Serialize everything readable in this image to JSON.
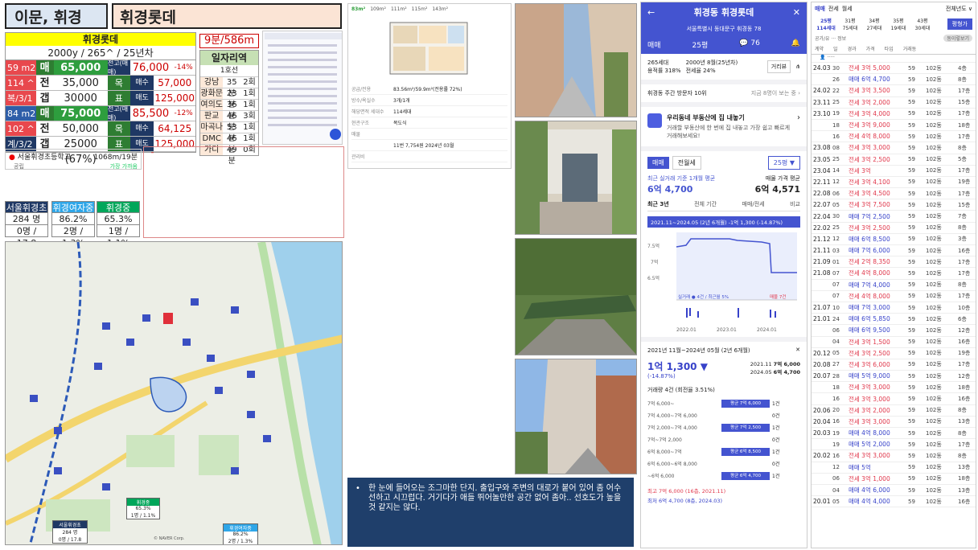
{
  "header": {
    "region": "이문, 휘경",
    "complex": "휘경롯데"
  },
  "price_table": {
    "title": "휘경롯데",
    "subtitle": "2000y / 265^ / 25년차",
    "rows": [
      {
        "a": "59 m2",
        "b": "매",
        "c": "65,000",
        "d": "전고(매매)",
        "e": "76,000",
        "f": "-14%",
        "color": "red"
      },
      {
        "a": "114 ^",
        "b": "전",
        "c": "35,000",
        "d": "목",
        "e": "매수",
        "f": "57,000",
        "color": "red"
      },
      {
        "a": "복/3/1",
        "b": "갭",
        "c": "30000 (54%)",
        "d": "표",
        "e": "매도",
        "f": "125,000",
        "color": "red"
      },
      {
        "a": "84 m2",
        "b": "매",
        "c": "75,000",
        "d": "전고(매매)",
        "e": "85,500",
        "f": "-12%",
        "color": "blue"
      },
      {
        "a": "102 ^",
        "b": "전",
        "c": "50,000",
        "d": "목",
        "e": "매수",
        "f": "64,125",
        "color": "red"
      },
      {
        "a": "계/3/2",
        "b": "갭",
        "c": "25000 (67%)",
        "d": "표",
        "e": "매도",
        "f": "125,000",
        "color": "dk"
      }
    ]
  },
  "distance": "9분/586m",
  "work": {
    "title": "일자리역",
    "sub": "1호선",
    "rows": [
      [
        "강남",
        "35분",
        "2회"
      ],
      [
        "광화문",
        "23분",
        "1회"
      ],
      [
        "여의도",
        "36분",
        "1회"
      ],
      [
        "판교",
        "46분",
        "3회"
      ],
      [
        "마곡나루",
        "53분",
        "1회"
      ],
      [
        "DMC",
        "46분",
        "1회"
      ],
      [
        "가디",
        "49분",
        "0회"
      ]
    ]
  },
  "school": {
    "name": "서울휘경초등학교",
    "dist": "1068m/19분",
    "tag1": "공립",
    "tag2": "가장 가까움"
  },
  "schools": [
    {
      "name": "서울휘경초",
      "l2": "284 명",
      "l3": "0명 / 17.8",
      "color": "dk"
    },
    {
      "name": "휘경여자중",
      "l2": "86.2%",
      "l3": "2명 / 1.3%",
      "color": "cy"
    },
    {
      "name": "휘경중",
      "l2": "65.3%",
      "l3": "1명 / 1.1%",
      "color": "gr"
    }
  ],
  "map_labels": {
    "school1": "휘경중",
    "school1_l2": "65.3%",
    "school1_l3": "1명 / 1.1%",
    "school2": "서울휘경초",
    "school2_l2": "284 명",
    "school2_l3": "0명 / 17.8",
    "school3": "휘경여자중",
    "school3_l2": "86.2%",
    "school3_l3": "2명 / 1.3%",
    "credit": "© NAVER Corp."
  },
  "floor": {
    "tabs": [
      "83m²",
      "109m²",
      "111m²",
      "115m²",
      "143m²"
    ],
    "f1": "공급/전용",
    "f1v": "83.56m²/59.9m²(전용률 72%)",
    "f2": "방수/욕실수",
    "f2v": "3개/1개",
    "f3": "해당면적 세대수",
    "f3v": "114세대",
    "f4": "현관구조",
    "f4v": "복도식",
    "f5": "매물",
    "f6": "11번 7,754원  2024년 03월",
    "f7": "관리비"
  },
  "note": "한 눈에 들어오는 조그마한 단지. 출입구와 주변의 대로가 붙어 있어 좀 어수선하고 시끄럽다. 거기다가 애들 뛰어놀만한 공간 없어 좀아.. 선호도가 높을 것 같지는 않다.",
  "mobile": {
    "title": "휘경동 휘경롯데",
    "addr": "서울특별시 동대문구 휘경동 78",
    "tab1": "매매",
    "tab2": "25평",
    "comments": "76",
    "info1": "265세대",
    "info2": "2000년 8월(25년차)",
    "info3": "용적률 318%",
    "info4": "전세율 24%",
    "dist_btn": "거리뷰",
    "visits": "휘경동 주간 방문자 10위",
    "visits_r": "지금 8명이 보는 중 ›",
    "ad_t": "우리동네 부동산에 집 내놓기",
    "ad_s": "거래할 부동산에 한 번에 집 내놓고 가장 쉽고 빠르게 거래해보세요!",
    "t_buy": "매매",
    "t_rent": "전월세",
    "size_sel": "25평 ▼",
    "recent_l": "최근 실거래 기준 1개월 평균",
    "recent_v": "6억 4,700",
    "listing_l": "매물 가격 평균",
    "listing_v": "6억 4,571",
    "range_tabs": [
      "최근 3년",
      "전체 기간",
      "매매/전세",
      "비교"
    ],
    "chart_head": "2021.11~2024.05 (2년 6개월) -1억 1,300 (-14.87%)",
    "y_labels": [
      "7.5억",
      "7억",
      "6.5억"
    ],
    "x_labels": [
      "2022.01",
      "2023.01",
      "2024.01"
    ],
    "legend": "실거래 ● 4건 / 최근월 5%",
    "legend2": "매물 7건",
    "period": "2021년 11월~2024년 05월 (2년 6개월)",
    "change": "1억 1,300 ▼",
    "change_pct": "(-14.87%)",
    "hi_d": "2021.11",
    "hi_v": "7억 6,000",
    "lo_d": "2024.05",
    "lo_v": "6억 4,700",
    "vol": "거래량 4건 (회전율 3.51%)",
    "bins": [
      {
        "r": "7억 6,000~",
        "bar": "평균 7억 6,000",
        "n": "1건"
      },
      {
        "r": "7억 4,000~7억 6,000",
        "bar": "",
        "n": "0건"
      },
      {
        "r": "7억 2,000~7억 4,000",
        "bar": "평균 7억 2,500",
        "n": "1건"
      },
      {
        "r": "7억~7억 2,000",
        "bar": "",
        "n": "0건"
      },
      {
        "r": "6억 8,000~7억",
        "bar": "평균 6억 8,500",
        "n": "1건"
      },
      {
        "r": "6억 6,000~6억 8,000",
        "bar": "",
        "n": "0건"
      },
      {
        "r": "~6억 6,000",
        "bar": "평균 6억 4,700",
        "n": "1건"
      }
    ],
    "max": "최고 7억 6,000 (16층, 2021.11)",
    "min": "최저 6억 4,700 (8층, 2024.03)"
  },
  "trades": {
    "top_tabs": [
      "매매",
      "전세",
      "월세"
    ],
    "filter": "전체년도 ∨",
    "sizes": [
      {
        "a": "25평",
        "b": "114세대"
      },
      {
        "a": "31평",
        "b": "75세대"
      },
      {
        "a": "34평",
        "b": "27세대"
      },
      {
        "a": "35평",
        "b": "19세대"
      },
      {
        "a": "43평",
        "b": "30세대"
      }
    ],
    "btn": "평형가",
    "sub": "공가/유 ··· 정보",
    "sub_btn": "동이렇보기",
    "cols": [
      "계약",
      "일",
      "경과",
      "가격",
      "타입",
      "거래동"
    ],
    "rows": [
      [
        "24.03",
        "30",
        "전세 3억 5,000",
        "59",
        "102동",
        "4층",
        0
      ],
      [
        "",
        "26",
        "매매 6억 4,700",
        "59",
        "102동",
        "8층",
        1
      ],
      [
        "24.02",
        "22",
        "전세 3억 3,500",
        "59",
        "102동",
        "17층",
        0
      ],
      [
        "23.11",
        "25",
        "전세 3억 2,000",
        "59",
        "102동",
        "15층",
        0
      ],
      [
        "23.10",
        "19",
        "전세 3억 4,000",
        "59",
        "102동",
        "17층",
        0
      ],
      [
        "",
        "18",
        "전세 3억 9,000",
        "59",
        "102동",
        "18층",
        0
      ],
      [
        "",
        "16",
        "전세 4억 8,000",
        "59",
        "102동",
        "17층",
        0
      ],
      [
        "23.08",
        "08",
        "전세 3억 3,000",
        "59",
        "102동",
        "8층",
        0
      ],
      [
        "23.05",
        "25",
        "전세 3억 2,500",
        "59",
        "102동",
        "5층",
        0
      ],
      [
        "23.04",
        "14",
        "전세 3억",
        "59",
        "102동",
        "17층",
        0
      ],
      [
        "22.11",
        "12",
        "전세 3억 4,100",
        "59",
        "102동",
        "19층",
        0
      ],
      [
        "22.08",
        "06",
        "전세 3억 4,500",
        "59",
        "102동",
        "17층",
        0
      ],
      [
        "22.07",
        "05",
        "전세 3억 7,500",
        "59",
        "102동",
        "15층",
        0
      ],
      [
        "22.04",
        "30",
        "매매 7억 2,500",
        "59",
        "102동",
        "7층",
        1
      ],
      [
        "22.02",
        "25",
        "전세 3억 2,500",
        "59",
        "102동",
        "8층",
        0
      ],
      [
        "21.12",
        "12",
        "매매 6억 8,500",
        "59",
        "102동",
        "3층",
        1
      ],
      [
        "21.11",
        "03",
        "매매 7억 6,000",
        "59",
        "102동",
        "16층",
        1
      ],
      [
        "21.09",
        "01",
        "전세 2억 8,350",
        "59",
        "102동",
        "17층",
        0
      ],
      [
        "21.08",
        "07",
        "전세 4억 8,000",
        "59",
        "102동",
        "17층",
        0
      ],
      [
        "",
        "07",
        "매매 7억 4,000",
        "59",
        "102동",
        "8층",
        1
      ],
      [
        "",
        "07",
        "전세 4억 8,000",
        "59",
        "102동",
        "17층",
        0
      ],
      [
        "21.07",
        "10",
        "매매 7억 3,000",
        "59",
        "102동",
        "10층",
        1
      ],
      [
        "21.01",
        "24",
        "매매 6억 5,850",
        "59",
        "102동",
        "6층",
        1
      ],
      [
        "",
        "06",
        "매매 6억 9,500",
        "59",
        "102동",
        "12층",
        1
      ],
      [
        "",
        "04",
        "전세 3억 1,500",
        "59",
        "102동",
        "16층",
        0
      ],
      [
        "20.12",
        "05",
        "전세 3억 2,500",
        "59",
        "102동",
        "19층",
        0
      ],
      [
        "20.08",
        "27",
        "전세 3억 6,000",
        "59",
        "102동",
        "17층",
        0
      ],
      [
        "20.07",
        "28",
        "매매 5억 9,000",
        "59",
        "102동",
        "12층",
        1
      ],
      [
        "",
        "18",
        "전세 3억 3,000",
        "59",
        "102동",
        "18층",
        0
      ],
      [
        "",
        "16",
        "전세 3억 3,000",
        "59",
        "102동",
        "16층",
        0
      ],
      [
        "20.06",
        "20",
        "전세 3억 2,000",
        "59",
        "102동",
        "8층",
        0
      ],
      [
        "20.04",
        "16",
        "전세 3억 3,000",
        "59",
        "102동",
        "13층",
        0
      ],
      [
        "20.03",
        "19",
        "매매 4억 8,000",
        "59",
        "102동",
        "8층",
        1
      ],
      [
        "",
        "19",
        "매매 5억 2,000",
        "59",
        "102동",
        "17층",
        1
      ],
      [
        "20.02",
        "16",
        "전세 3억 3,000",
        "59",
        "102동",
        "8층",
        0
      ],
      [
        "",
        "12",
        "매매 5억",
        "59",
        "102동",
        "13층",
        1
      ],
      [
        "",
        "06",
        "전세 3억 1,000",
        "59",
        "102동",
        "18층",
        0
      ],
      [
        "",
        "04",
        "매매 4억 6,000",
        "59",
        "102동",
        "13층",
        1
      ],
      [
        "20.01",
        "05",
        "매매 4억 4,000",
        "59",
        "102동",
        "16층",
        1
      ]
    ]
  }
}
